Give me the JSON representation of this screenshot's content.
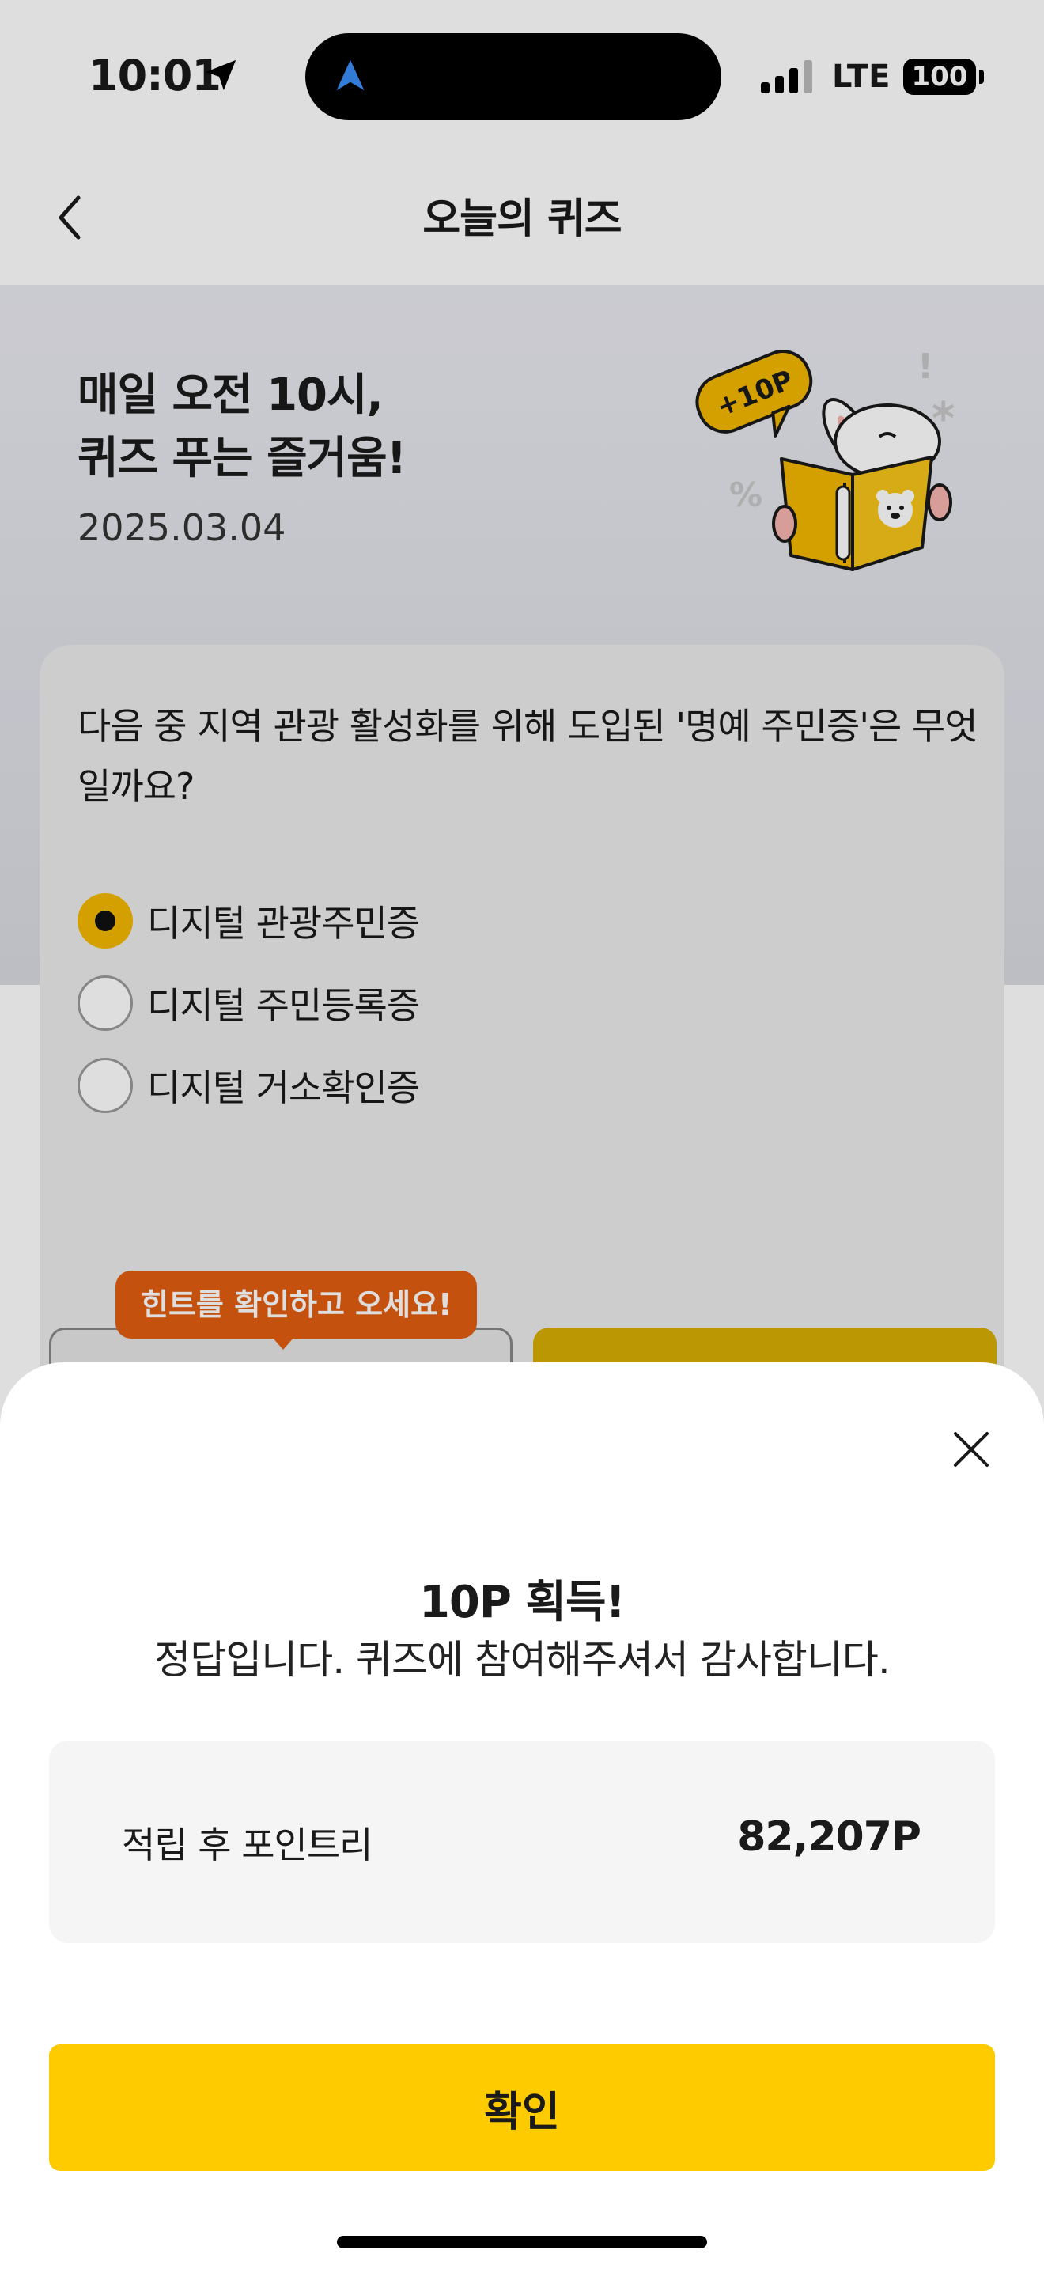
{
  "status_bar": {
    "time": "10:01",
    "network": "LTE",
    "battery": "100"
  },
  "header": {
    "title": "오늘의 퀴즈"
  },
  "hero": {
    "title_line1": "매일 오전 10시,",
    "title_line2": "퀴즈 푸는 즐거움!",
    "date": "2025.03.04",
    "badge": "+10P"
  },
  "quiz": {
    "question": "다음 중 지역 관광 활성화를 위해 도입된 '명예 주민증'은 무엇일까요?",
    "options": [
      {
        "label": "디지털 관광주민증",
        "selected": true
      },
      {
        "label": "디지털 주민등록증",
        "selected": false
      },
      {
        "label": "디지털 거소확인증",
        "selected": false
      }
    ],
    "hint_tooltip": "힌트를 확인하고 오세요!"
  },
  "result_sheet": {
    "title": "10P 획득!",
    "message": "정답입니다. 퀴즈에 참여해주셔서 감사합니다.",
    "points_label": "적립 후 포인트리",
    "points_value": "82,207P",
    "confirm_label": "확인"
  },
  "colors": {
    "accent_yellow": "#fecb00",
    "radio_selected": "#f4b800",
    "tooltip": "#e35d12"
  }
}
